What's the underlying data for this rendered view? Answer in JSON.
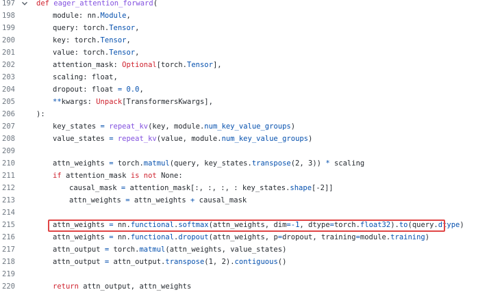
{
  "lines": [
    {
      "n": "197",
      "parts": [
        {
          "t": "def ",
          "c": "kw"
        },
        {
          "t": "eager_attention_forward",
          "c": "fn"
        },
        {
          "t": "(",
          "c": ""
        }
      ]
    },
    {
      "n": "198",
      "parts": [
        {
          "t": "module: nn.",
          "c": ""
        },
        {
          "t": "Module",
          "c": "cls"
        },
        {
          "t": ",",
          "c": ""
        }
      ]
    },
    {
      "n": "199",
      "parts": [
        {
          "t": "query: torch.",
          "c": ""
        },
        {
          "t": "Tensor",
          "c": "cls"
        },
        {
          "t": ",",
          "c": ""
        }
      ]
    },
    {
      "n": "200",
      "parts": [
        {
          "t": "key: torch.",
          "c": ""
        },
        {
          "t": "Tensor",
          "c": "cls"
        },
        {
          "t": ",",
          "c": ""
        }
      ]
    },
    {
      "n": "201",
      "parts": [
        {
          "t": "value: torch.",
          "c": ""
        },
        {
          "t": "Tensor",
          "c": "cls"
        },
        {
          "t": ",",
          "c": ""
        }
      ]
    },
    {
      "n": "202",
      "parts": [
        {
          "t": "attention_mask: ",
          "c": ""
        },
        {
          "t": "Optional",
          "c": "kw"
        },
        {
          "t": "[torch.",
          "c": ""
        },
        {
          "t": "Tensor",
          "c": "cls"
        },
        {
          "t": "],",
          "c": ""
        }
      ]
    },
    {
      "n": "203",
      "parts": [
        {
          "t": "scaling: float,",
          "c": ""
        }
      ]
    },
    {
      "n": "204",
      "parts": [
        {
          "t": "dropout: float ",
          "c": ""
        },
        {
          "t": "=",
          "c": "op"
        },
        {
          "t": " ",
          "c": ""
        },
        {
          "t": "0.0",
          "c": "num"
        },
        {
          "t": ",",
          "c": ""
        }
      ]
    },
    {
      "n": "205",
      "parts": [
        {
          "t": "**",
          "c": "op"
        },
        {
          "t": "kwargs: ",
          "c": ""
        },
        {
          "t": "Unpack",
          "c": "kw"
        },
        {
          "t": "[TransformersKwargs],",
          "c": ""
        }
      ]
    },
    {
      "n": "206",
      "parts": [
        {
          "t": "):",
          "c": ""
        }
      ]
    },
    {
      "n": "207",
      "parts": [
        {
          "t": "key_states ",
          "c": ""
        },
        {
          "t": "=",
          "c": "op"
        },
        {
          "t": " ",
          "c": ""
        },
        {
          "t": "repeat_kv",
          "c": "fn"
        },
        {
          "t": "(key, module.",
          "c": ""
        },
        {
          "t": "num_key_value_groups",
          "c": "attr"
        },
        {
          "t": ")",
          "c": ""
        }
      ]
    },
    {
      "n": "208",
      "parts": [
        {
          "t": "value_states ",
          "c": ""
        },
        {
          "t": "=",
          "c": "op"
        },
        {
          "t": " ",
          "c": ""
        },
        {
          "t": "repeat_kv",
          "c": "fn"
        },
        {
          "t": "(value, module.",
          "c": ""
        },
        {
          "t": "num_key_value_groups",
          "c": "attr"
        },
        {
          "t": ")",
          "c": ""
        }
      ]
    },
    {
      "n": "209",
      "parts": []
    },
    {
      "n": "210",
      "parts": [
        {
          "t": "attn_weights ",
          "c": ""
        },
        {
          "t": "=",
          "c": "op"
        },
        {
          "t": " torch.",
          "c": ""
        },
        {
          "t": "matmul",
          "c": "attr"
        },
        {
          "t": "(query, key_states.",
          "c": ""
        },
        {
          "t": "transpose",
          "c": "attr"
        },
        {
          "t": "(2, 3)) ",
          "c": ""
        },
        {
          "t": "*",
          "c": "op"
        },
        {
          "t": " scaling",
          "c": ""
        }
      ]
    },
    {
      "n": "211",
      "parts": [
        {
          "t": "if",
          "c": "kw"
        },
        {
          "t": " attention_mask ",
          "c": ""
        },
        {
          "t": "is not",
          "c": "kw"
        },
        {
          "t": " None:",
          "c": ""
        }
      ]
    },
    {
      "n": "212",
      "parts": [
        {
          "t": "causal_mask ",
          "c": ""
        },
        {
          "t": "=",
          "c": "op"
        },
        {
          "t": " attention_mask[:, :, :, : key_states.",
          "c": ""
        },
        {
          "t": "shape",
          "c": "attr"
        },
        {
          "t": "[-2]]",
          "c": ""
        }
      ]
    },
    {
      "n": "213",
      "parts": [
        {
          "t": "attn_weights ",
          "c": ""
        },
        {
          "t": "=",
          "c": "op"
        },
        {
          "t": " attn_weights ",
          "c": ""
        },
        {
          "t": "+",
          "c": "op"
        },
        {
          "t": " causal_mask",
          "c": ""
        }
      ]
    },
    {
      "n": "214",
      "parts": []
    },
    {
      "n": "215",
      "parts": [
        {
          "t": "attn_weights ",
          "c": ""
        },
        {
          "t": "=",
          "c": "op"
        },
        {
          "t": " nn.",
          "c": ""
        },
        {
          "t": "functional",
          "c": "attr"
        },
        {
          "t": ".",
          "c": ""
        },
        {
          "t": "softmax",
          "c": "attr"
        },
        {
          "t": "(attn_weights, dim",
          "c": ""
        },
        {
          "t": "=-1",
          "c": "num"
        },
        {
          "t": ", dtype",
          "c": ""
        },
        {
          "t": "=",
          "c": "op"
        },
        {
          "t": "torch.",
          "c": ""
        },
        {
          "t": "float32",
          "c": "attr"
        },
        {
          "t": ").",
          "c": ""
        },
        {
          "t": "to",
          "c": "attr"
        },
        {
          "t": "(query.",
          "c": ""
        },
        {
          "t": "dtype",
          "c": "attr"
        },
        {
          "t": ")",
          "c": ""
        }
      ]
    },
    {
      "n": "216",
      "parts": [
        {
          "t": "attn_weights ",
          "c": ""
        },
        {
          "t": "=",
          "c": "op"
        },
        {
          "t": " nn.",
          "c": ""
        },
        {
          "t": "functional",
          "c": "attr"
        },
        {
          "t": ".",
          "c": ""
        },
        {
          "t": "dropout",
          "c": "attr"
        },
        {
          "t": "(attn_weights, p",
          "c": ""
        },
        {
          "t": "=",
          "c": "op"
        },
        {
          "t": "dropout, training",
          "c": ""
        },
        {
          "t": "=",
          "c": "op"
        },
        {
          "t": "module.",
          "c": ""
        },
        {
          "t": "training",
          "c": "attr"
        },
        {
          "t": ")",
          "c": ""
        }
      ]
    },
    {
      "n": "217",
      "parts": [
        {
          "t": "attn_output ",
          "c": ""
        },
        {
          "t": "=",
          "c": "op"
        },
        {
          "t": " torch.",
          "c": ""
        },
        {
          "t": "matmul",
          "c": "attr"
        },
        {
          "t": "(attn_weights, value_states)",
          "c": ""
        }
      ]
    },
    {
      "n": "218",
      "parts": [
        {
          "t": "attn_output ",
          "c": ""
        },
        {
          "t": "=",
          "c": "op"
        },
        {
          "t": " attn_output.",
          "c": ""
        },
        {
          "t": "transpose",
          "c": "attr"
        },
        {
          "t": "(1, 2).",
          "c": ""
        },
        {
          "t": "contiguous",
          "c": "attr"
        },
        {
          "t": "()",
          "c": ""
        }
      ]
    },
    {
      "n": "219",
      "parts": []
    },
    {
      "n": "220",
      "parts": [
        {
          "t": "return",
          "c": "kw"
        },
        {
          "t": " attn_output, attn_weights",
          "c": ""
        }
      ]
    }
  ],
  "fold_icon": "chevron-down-icon",
  "highlight_line": "215",
  "colors": {
    "keyword": "#cf222e",
    "function": "#8250df",
    "attribute": "#0550ae",
    "highlight_border": "#e04444",
    "line_number": "#6e7781"
  }
}
